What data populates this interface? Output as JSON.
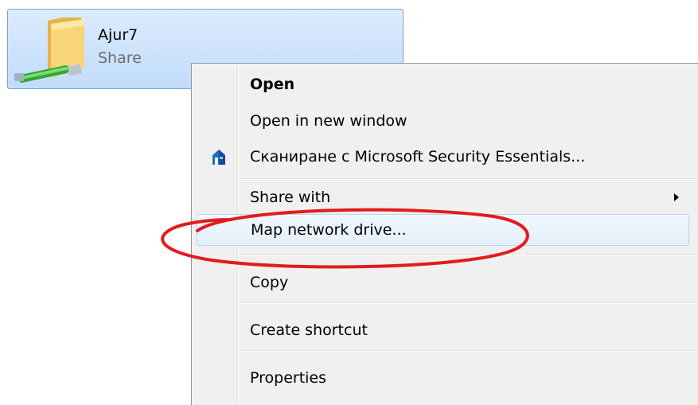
{
  "share": {
    "name": "Ajur7",
    "subtitle": "Share"
  },
  "context_menu": {
    "items": [
      {
        "label": "Open",
        "bold": true
      },
      {
        "label": "Open in new window"
      },
      {
        "label": "Сканиране с Microsoft Security Essentials...",
        "icon": "security-essentials-icon"
      },
      {
        "label": "Share with",
        "submenu": true
      },
      {
        "label": "Map network drive...",
        "highlighted": true
      },
      {
        "label": "Copy"
      },
      {
        "label": "Create shortcut"
      },
      {
        "label": "Properties"
      }
    ]
  },
  "annotation": {
    "shape": "ellipse",
    "color": "#e21b1b",
    "target": "Map network drive..."
  },
  "colors": {
    "selection": "#c9e0fc",
    "menu_bg": "#f0f0f0",
    "highlight": "#e4effc"
  }
}
